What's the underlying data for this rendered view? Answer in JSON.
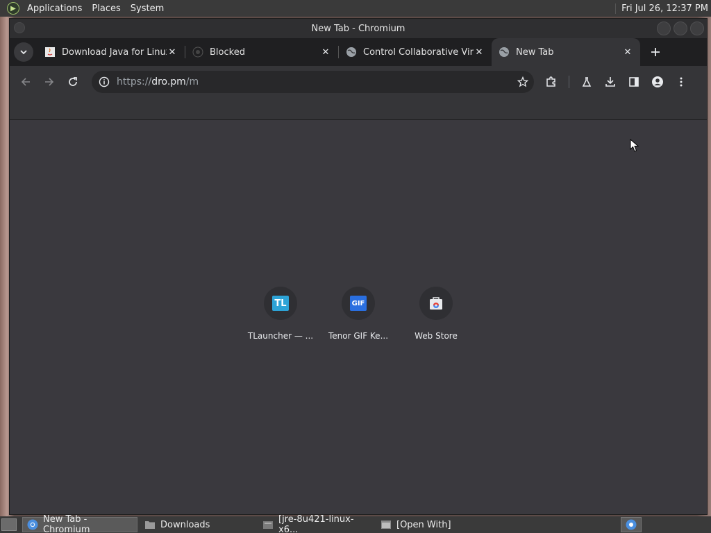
{
  "desktop": {
    "top_panel": {
      "menus": [
        "Applications",
        "Places",
        "System"
      ],
      "clock": "Fri Jul 26, 12:37 PM"
    },
    "taskbar": {
      "tasks": [
        {
          "label": "New Tab - Chromium",
          "icon": "chromium-icon",
          "active": true
        },
        {
          "label": "Downloads",
          "icon": "folder-icon",
          "active": false
        },
        {
          "label": "[jre-8u421-linux-x6...",
          "icon": "archive-icon",
          "active": false
        },
        {
          "label": "[Open With]",
          "icon": "window-icon",
          "active": false
        }
      ]
    }
  },
  "window": {
    "title": "New Tab - Chromium"
  },
  "tabs": [
    {
      "title": "Download Java for Linux",
      "icon": "java-icon",
      "active": false
    },
    {
      "title": "Blocked",
      "icon": "github-icon",
      "active": false
    },
    {
      "title": "Control Collaborative Virt",
      "icon": "globe-icon",
      "active": false
    },
    {
      "title": "New Tab",
      "icon": "globe-icon",
      "active": true
    }
  ],
  "toolbar": {
    "url_scheme": "https://",
    "url_host": "dro.pm",
    "url_path": "/m"
  },
  "shortcuts": [
    {
      "title": "TLauncher — ...",
      "icon_text": "TL"
    },
    {
      "title": "Tenor GIF Ke...",
      "icon_text": "GIF"
    },
    {
      "title": "Web Store",
      "icon_text": ""
    }
  ],
  "colors": {
    "background": "#3a393e",
    "toolbar": "#353538",
    "tabstrip": "#1f1f21"
  }
}
